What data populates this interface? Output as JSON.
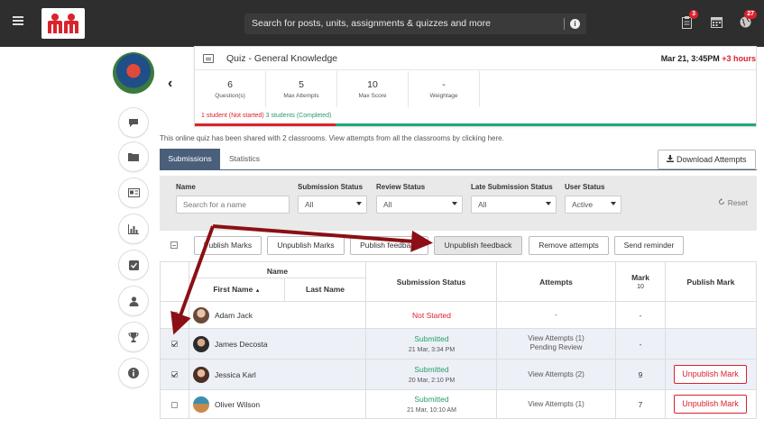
{
  "topbar": {
    "search_placeholder": "Search for posts, units, assignments & quizzes and more",
    "badges": {
      "assignments": "3",
      "notifications": "27"
    }
  },
  "quiz": {
    "title": "Quiz - General Knowledge",
    "date": "Mar 21, 3:45PM",
    "late": "+3 hours",
    "stats": [
      {
        "value": "6",
        "label": "Question(s)"
      },
      {
        "value": "5",
        "label": "Max Attempts"
      },
      {
        "value": "10",
        "label": "Max Score"
      },
      {
        "value": "-",
        "label": "Weightage"
      }
    ],
    "progress_not_started": "1 student (Not started)",
    "progress_completed": "3 students (Completed)",
    "not_started_fraction": 0.25
  },
  "shared_note": "This online quiz has been shared with 2 classrooms. View attempts from all the classrooms by ",
  "shared_link": "clicking here.",
  "tabs": {
    "submissions": "Submissions",
    "statistics": "Statistics"
  },
  "download_label": "Download Attempts",
  "filters": {
    "name_label": "Name",
    "name_placeholder": "Search for a name",
    "submission_status_label": "Submission Status",
    "submission_status_value": "All",
    "review_status_label": "Review Status",
    "review_status_value": "All",
    "late_submission_label": "Late Submission Status",
    "late_submission_value": "All",
    "user_status_label": "User Status",
    "user_status_value": "Active",
    "reset_label": "Reset"
  },
  "actions": {
    "publish_marks": "Publish Marks",
    "unpublish_marks": "Unpublish Marks",
    "publish_feedback": "Publish feedback",
    "unpublish_feedback": "Unpublish feedback",
    "remove_attempts": "Remove attempts",
    "send_reminder": "Send reminder"
  },
  "table": {
    "headers": {
      "name": "Name",
      "first_name": "First Name",
      "last_name": "Last Name",
      "submission_status": "Submission Status",
      "attempts": "Attempts",
      "mark": "Mark",
      "mark_max": "10",
      "publish_mark": "Publish Mark"
    },
    "rows": [
      {
        "name": "Adam Jack",
        "status": "Not Started",
        "status_date": "",
        "attempts": "-",
        "attempts_sub": "",
        "mark": "-",
        "publish": ""
      },
      {
        "name": "James Decosta",
        "status": "Submitted",
        "status_date": "21 Mar, 3:34 PM",
        "attempts": "View Attempts (1)",
        "attempts_sub": "Pending Review",
        "mark": "-",
        "publish": ""
      },
      {
        "name": "Jessica Karl",
        "status": "Submitted",
        "status_date": "20 Mar, 2:10 PM",
        "attempts": "View Attempts (2)",
        "attempts_sub": "",
        "mark": "9",
        "publish": "Unpublish Mark"
      },
      {
        "name": "Oliver Wilson",
        "status": "Submitted",
        "status_date": "21 Mar, 10:10 AM",
        "attempts": "View Attempts (1)",
        "attempts_sub": "",
        "mark": "7",
        "publish": "Unpublish Mark"
      }
    ]
  },
  "colors": {
    "topbar": "#2e2e2e",
    "accent_tab": "#4a5f7a",
    "red": "#d9232d",
    "green": "#2a9b6a",
    "annotation_arrow": "#8b0f14"
  }
}
